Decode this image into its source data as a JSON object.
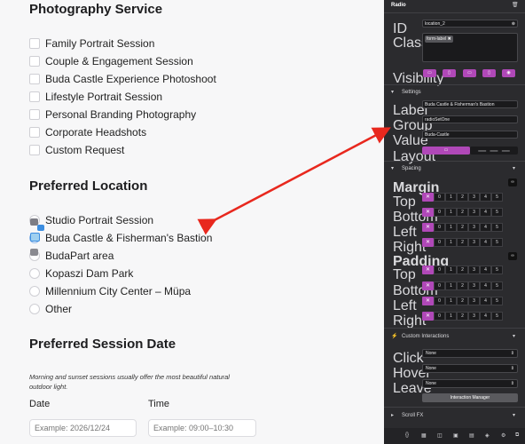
{
  "form": {
    "photography_title": "Photography Service",
    "services": [
      "Family Portrait Session",
      "Couple & Engagement Session",
      "Buda Castle Experience Photoshoot",
      "Lifestyle Portrait Session",
      "Personal Branding Photography",
      "Corporate Headshots",
      "Custom Request"
    ],
    "location_title": "Preferred Location",
    "locations": [
      "Studio Portrait Session",
      "Buda Castle & Fisherman's Bastion",
      "BudaPart area",
      "Kopaszi Dam Park",
      "Millennium City Center – Müpa",
      "Other"
    ],
    "date_title": "Preferred Session Date",
    "note": "Morning and sunset sessions usually offer the most beautiful natural outdoor light.",
    "date_label": "Date",
    "time_label": "Time",
    "date_placeholder": "Example: 2026/12/24",
    "time_placeholder": "Example: 09:00–10:30"
  },
  "panel": {
    "title": "Radio",
    "trash_icon": "trash-icon",
    "id_label": "ID",
    "id_value": "location_2",
    "classes_label": "Classes",
    "class_tag": "form-label",
    "visibility_label": "Visibility",
    "visibility_icons": [
      "laptop-icon",
      "tablet-icon",
      "tablet-landscape-icon",
      "phone-icon",
      "eye-icon"
    ],
    "settings_title": "Settings",
    "label_label": "Label",
    "label_value": "Buda Castle & Fisherman's Bastion",
    "group_label": "Group",
    "group_value": "radioSetOne",
    "value_label": "Value",
    "value_value": "Buda-Castle",
    "layout_label": "Layout",
    "layout_option_2": "– – –",
    "spacing_title": "Spacing",
    "margin_title": "Margin",
    "padding_title": "Padding",
    "sides": [
      "Top",
      "Bottom",
      "Left",
      "Right"
    ],
    "scale": [
      "0",
      "1",
      "2",
      "3",
      "4",
      "5"
    ],
    "x_glyph": "✕",
    "custom_title": "Custom Interactions",
    "click_label": "Click",
    "hover_label": "Hover",
    "leave_label": "Leave",
    "none_value": "None",
    "manager_button": "Interaction Manager",
    "scroll_title": "Scroll FX",
    "accent": "#b048b8"
  },
  "annotation": {
    "arrow_color": "#e8281e"
  }
}
